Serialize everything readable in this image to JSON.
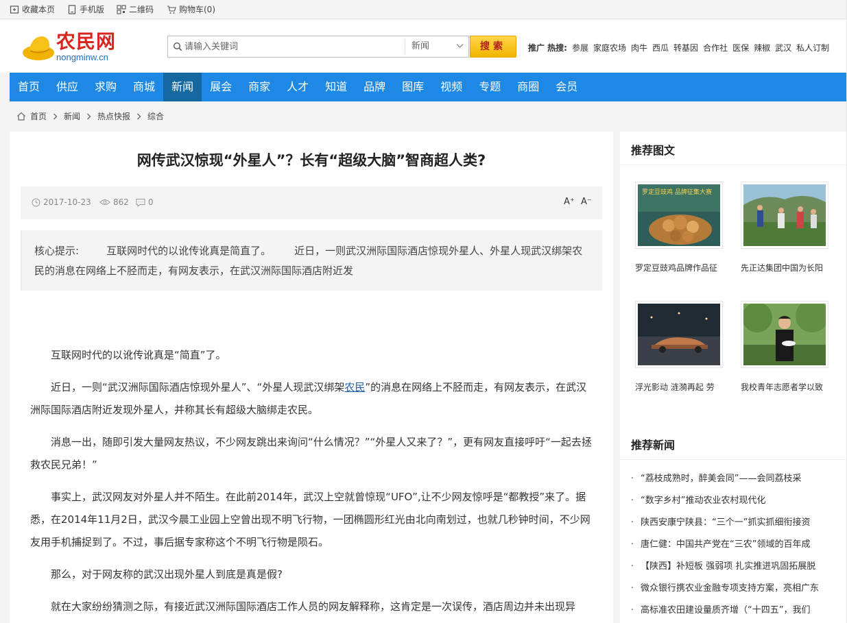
{
  "topbar": {
    "favorite": "收藏本页",
    "mobile": "手机版",
    "qrcode": "二维码",
    "cart": "购物车(0)"
  },
  "logo": {
    "cn": "农民网",
    "en": "nongminw.cn"
  },
  "search": {
    "placeholder": "请输入关键词",
    "category": "新闻",
    "button": "搜索"
  },
  "hot": {
    "label": "推广 热搜:",
    "keywords": [
      "参展",
      "家庭农场",
      "肉牛",
      "西瓜",
      "转基因",
      "合作社",
      "医保",
      "辣椒",
      "武汉",
      "私人订制"
    ]
  },
  "nav": {
    "items": [
      "首页",
      "供应",
      "求购",
      "商城",
      "新闻",
      "展会",
      "商家",
      "人才",
      "知道",
      "品牌",
      "图库",
      "视频",
      "专题",
      "商圈",
      "会员"
    ],
    "active": "新闻"
  },
  "breadcrumb": [
    "首页",
    "新闻",
    "热点快报",
    "综合"
  ],
  "article": {
    "title": "网传武汉惊现“外星人”？长有“超级大脑”智商超人类?",
    "date": "2017-10-23",
    "views": "862",
    "comments": "0",
    "font_up": "A⁺",
    "font_down": "A⁻",
    "summary_label": "核心提示:",
    "summary_text_1": "互联网时代的以讹传讹真是简直了。",
    "summary_text_2": "近日，一则武汉洲际国际酒店惊现外星人、外星人现武汉绑架农民的消息在网络上不胫而走，有网友表示，在武汉洲际国际酒店附近发",
    "p1": "互联网时代的以讹传讹真是“简直”了。",
    "p2_a": "近日，一则“武汉洲际国际酒店惊现外星人”、“外星人现武汉绑架",
    "p2_link": "农民",
    "p2_b": "”的消息在网络上不胫而走，有网友表示，在武汉洲际国际酒店附近发现外星人，并称其长有超级大脑绑走农民。",
    "p3": "消息一出，随即引发大量网友热议，不少网友跳出来询问“什么情况？”“外星人又来了？”，更有网友直接呼吁“一起去拯救农民兄弟！”",
    "p4": "事实上，武汉网友对外星人并不陌生。在此前2014年，武汉上空就曾惊现“UFO”,让不少网友惊呼是“都教授”来了。据悉，在2014年11月2日，武汉今晨工业园上空曾出现不明飞行物，一团椭圆形红光由北向南划过，也就几秒钟时间，不少网友用手机捕捉到了。不过，事后据专家称这个不明飞行物是陨石。",
    "p5": "那么，对于网友称的武汉出现外星人到底是真是假?",
    "p6": "就在大家纷纷猜测之际，有接近武汉洲际国际酒店工作人员的网友解释称，这肯定是一次误传，酒店周边并未出现异"
  },
  "sidebar": {
    "pic_title": "推荐图文",
    "pics": [
      {
        "caption": "罗定豆豉鸡品牌作品征",
        "overlay": "罗定豆豉鸡 品牌征集大赛"
      },
      {
        "caption": "先正达集团中国为长阳"
      },
      {
        "caption": "浮光影动 涟漪再起 劳"
      },
      {
        "caption": "我校青年志愿者学以致"
      }
    ],
    "news_title": "推荐新闻",
    "news": [
      "“荔枝成熟时，醉美会同”——会同荔枝采",
      "“数字乡村”推动农业农村现代化",
      "陕西安康宁陕县：“三个一”抓实抓细衔接资",
      "唐仁健：中国共产党在“三农”领域的百年成",
      "【陕西】补短板 强弱项 扎实推进巩固拓展脱",
      "微众银行携农业金融专项支持方案，亮相广东",
      "高标准农田建设量质齐增（“十四五”，我们"
    ],
    "bullet": "·"
  },
  "colors": {
    "nav": "#1e88e5",
    "nav_active": "#14679f",
    "logo_red": "#d7261e",
    "search_btn": "#f2b600"
  }
}
